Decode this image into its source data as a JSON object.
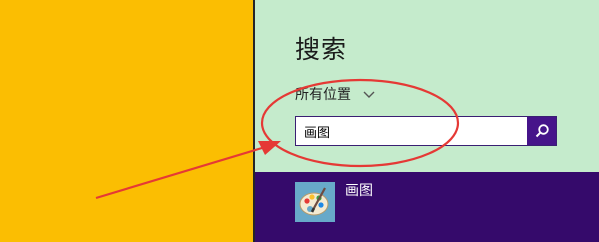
{
  "search_panel": {
    "title": "搜索",
    "scope_label": "所有位置",
    "query": "画图",
    "search_icon": "magnifier-icon",
    "dropdown_icon": "chevron-down-icon"
  },
  "results": [
    {
      "name": "画图",
      "icon": "paint-palette-icon"
    }
  ],
  "annotation": {
    "color": "#e53935",
    "shapes": [
      "ellipse",
      "arrow"
    ]
  },
  "colors": {
    "start_background": "#fbbe02",
    "panel_background": "#c5ebcc",
    "result_highlight": "#350a6b",
    "search_button": "#46148a"
  }
}
